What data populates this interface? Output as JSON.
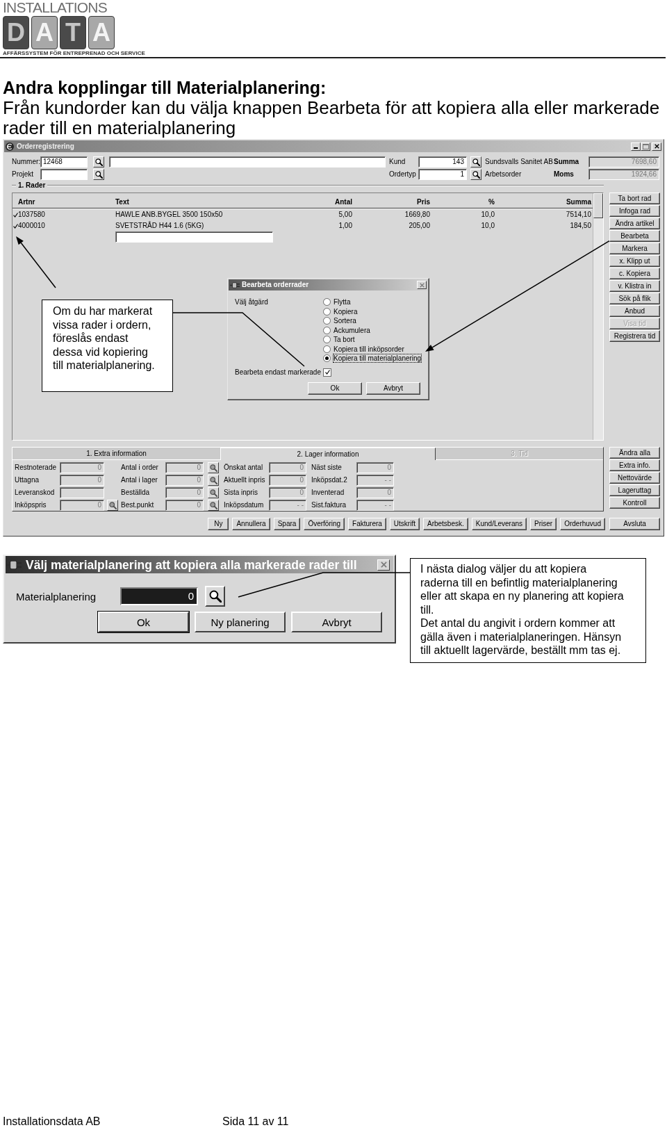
{
  "logo": {
    "wordmark": "INSTALLATIONS",
    "tiles": [
      {
        "letter": "D",
        "kind": "dark"
      },
      {
        "letter": "A",
        "kind": "light"
      },
      {
        "letter": "T",
        "kind": "dark"
      },
      {
        "letter": "A",
        "kind": "light"
      }
    ],
    "tagline": "AFFÄRSSYSTEM FÖR ENTREPRENAD OCH SERVICE"
  },
  "heading": "Andra kopplingar till Materialplanering:",
  "intro": "Från kundorder kan du välja knappen Bearbeta för att kopiera alla eller markerade rader till en materialplanering",
  "order_window": {
    "title": "Orderregistrering",
    "header": {
      "number": {
        "label": "Nummer:",
        "value": "12468"
      },
      "project": {
        "label": "Projekt"
      },
      "customer": {
        "label": "Kund",
        "value": "143",
        "name": "Sundsvalls Sanitet AB"
      },
      "order_type": {
        "label": "Ordertyp",
        "value": "1",
        "name": "Arbetsorder"
      },
      "total": {
        "label": "Summa",
        "value": "7698,60"
      },
      "vat": {
        "label": "Moms",
        "value": "1924,66"
      }
    },
    "rows_group": {
      "label": "1. Rader",
      "columns": [
        "Artnr",
        "Text",
        "Antal",
        "Pris",
        "%",
        "Summa"
      ],
      "rows": [
        {
          "checked": true,
          "cells": [
            "1037580",
            "HAWLE ANB.BYGEL 3500 150x50",
            "5,00",
            "1669,80",
            "10,0",
            "7514,10"
          ]
        },
        {
          "checked": true,
          "cells": [
            "4000010",
            "SVETSTRÅD H44 1.6 (5KG)",
            "1,00",
            "205,00",
            "10,0",
            "184,50"
          ]
        }
      ]
    },
    "side_buttons": [
      {
        "label": "Ta bort rad",
        "disabled": false
      },
      {
        "label": "Infoga rad",
        "disabled": false
      },
      {
        "label": "Ändra artikel",
        "disabled": false
      },
      {
        "label": "Bearbeta",
        "disabled": false
      },
      {
        "label": "Markera",
        "disabled": false
      },
      {
        "label": "x. Klipp ut",
        "disabled": false
      },
      {
        "label": "c. Kopiera",
        "disabled": false
      },
      {
        "label": "v. Klistra in",
        "disabled": false
      },
      {
        "label": "Sök på flik",
        "disabled": false
      },
      {
        "label": "Anbud",
        "disabled": false
      },
      {
        "label": "Visa tid",
        "disabled": true
      },
      {
        "label": "Registrera tid",
        "disabled": false
      }
    ],
    "info_panel": {
      "tabs": [
        {
          "label": "1. Extra information",
          "selected": false,
          "disabled": false
        },
        {
          "label": "2. Lager information",
          "selected": true,
          "disabled": false
        },
        {
          "label": "3. Tid",
          "selected": false,
          "disabled": true
        }
      ],
      "groups": [
        [
          {
            "label": "Restnoterade",
            "value": "0",
            "lookup": false
          },
          {
            "label": "Uttagna",
            "value": "0",
            "lookup": false
          },
          {
            "label": "Leveranskod",
            "lookup": false
          },
          {
            "label": "Inköpspris",
            "value": "0",
            "lookup": true
          }
        ],
        [
          {
            "label": "Antal i order",
            "value": "0",
            "lookup": true
          },
          {
            "label": "Antal i lager",
            "value": "0",
            "lookup": true
          },
          {
            "label": "Beställda",
            "value": "0",
            "lookup": true
          },
          {
            "label": "Best.punkt",
            "value": "0",
            "lookup": true
          }
        ],
        [
          {
            "label": "Önskat antal",
            "value": "0",
            "lookup": false
          },
          {
            "label": "Aktuellt inpris",
            "value": "0",
            "lookup": false
          },
          {
            "label": "Sista inpris",
            "value": "0",
            "lookup": false
          },
          {
            "label": "Inköpsdatum",
            "value": "- -",
            "lookup": false
          }
        ],
        [
          {
            "label": "Näst siste",
            "value": "0",
            "lookup": false
          },
          {
            "label": "Inköpsdat.2",
            "value": "- -",
            "lookup": false
          },
          {
            "label": "Inventerad",
            "value": "0",
            "lookup": false
          },
          {
            "label": "Sist.faktura",
            "value": "- -",
            "lookup": false
          }
        ]
      ]
    },
    "panel_buttons": [
      "Ändra alla",
      "Extra info.",
      "Nettovärde",
      "Lageruttag",
      "Kontroll"
    ],
    "action_buttons": [
      "Ny",
      "Annullera",
      "Spara",
      "Överföring",
      "Fakturera",
      "Utskrift",
      "Arbetsbesk.",
      "Kund/Leverans",
      "Priser",
      "Orderhuvud"
    ],
    "exit_button": "Avsluta",
    "process_dialog": {
      "title": "Bearbeta orderrader",
      "action_label": "Välj åtgärd",
      "options": [
        {
          "label": "Flytta",
          "selected": false
        },
        {
          "label": "Kopiera",
          "selected": false
        },
        {
          "label": "Sortera",
          "selected": false
        },
        {
          "label": "Ackumulera",
          "selected": false
        },
        {
          "label": "Ta bort",
          "selected": false
        },
        {
          "label": "Kopiera till inköpsorder",
          "selected": false
        },
        {
          "label": "Kopiera till materialplanering",
          "selected": true
        }
      ],
      "only_marked": {
        "label": "Bearbeta endast markerade",
        "checked": true
      },
      "buttons": [
        "Ok",
        "Avbryt"
      ]
    },
    "callout": "Om du har markerat\nvissa rader i ordern,\nföreslås endast\ndessa vid kopiering\ntill materialplanering."
  },
  "material_dialog": {
    "title": "Välj materialplanering att kopiera alla markerade rader till",
    "field_label": "Materialplanering",
    "value": "0",
    "highlighted": true,
    "buttons": [
      {
        "label": "Ok",
        "default": true
      },
      {
        "label": "Ny planering",
        "default": false
      },
      {
        "label": "Avbryt",
        "default": false
      }
    ]
  },
  "note": {
    "paragraphs": [
      "I nästa dialog väljer du att kopiera\nraderna till en befintlig materialplanering\neller att skapa en ny planering att kopiera\ntill.",
      "Det antal du angivit i ordern kommer att\ngälla även i materialplaneringen. Hänsyn\ntill aktuellt lagervärde, beställt mm tas ej."
    ]
  },
  "footer": {
    "company": "Installationsdata AB",
    "page": "Sida 11 av 11"
  }
}
